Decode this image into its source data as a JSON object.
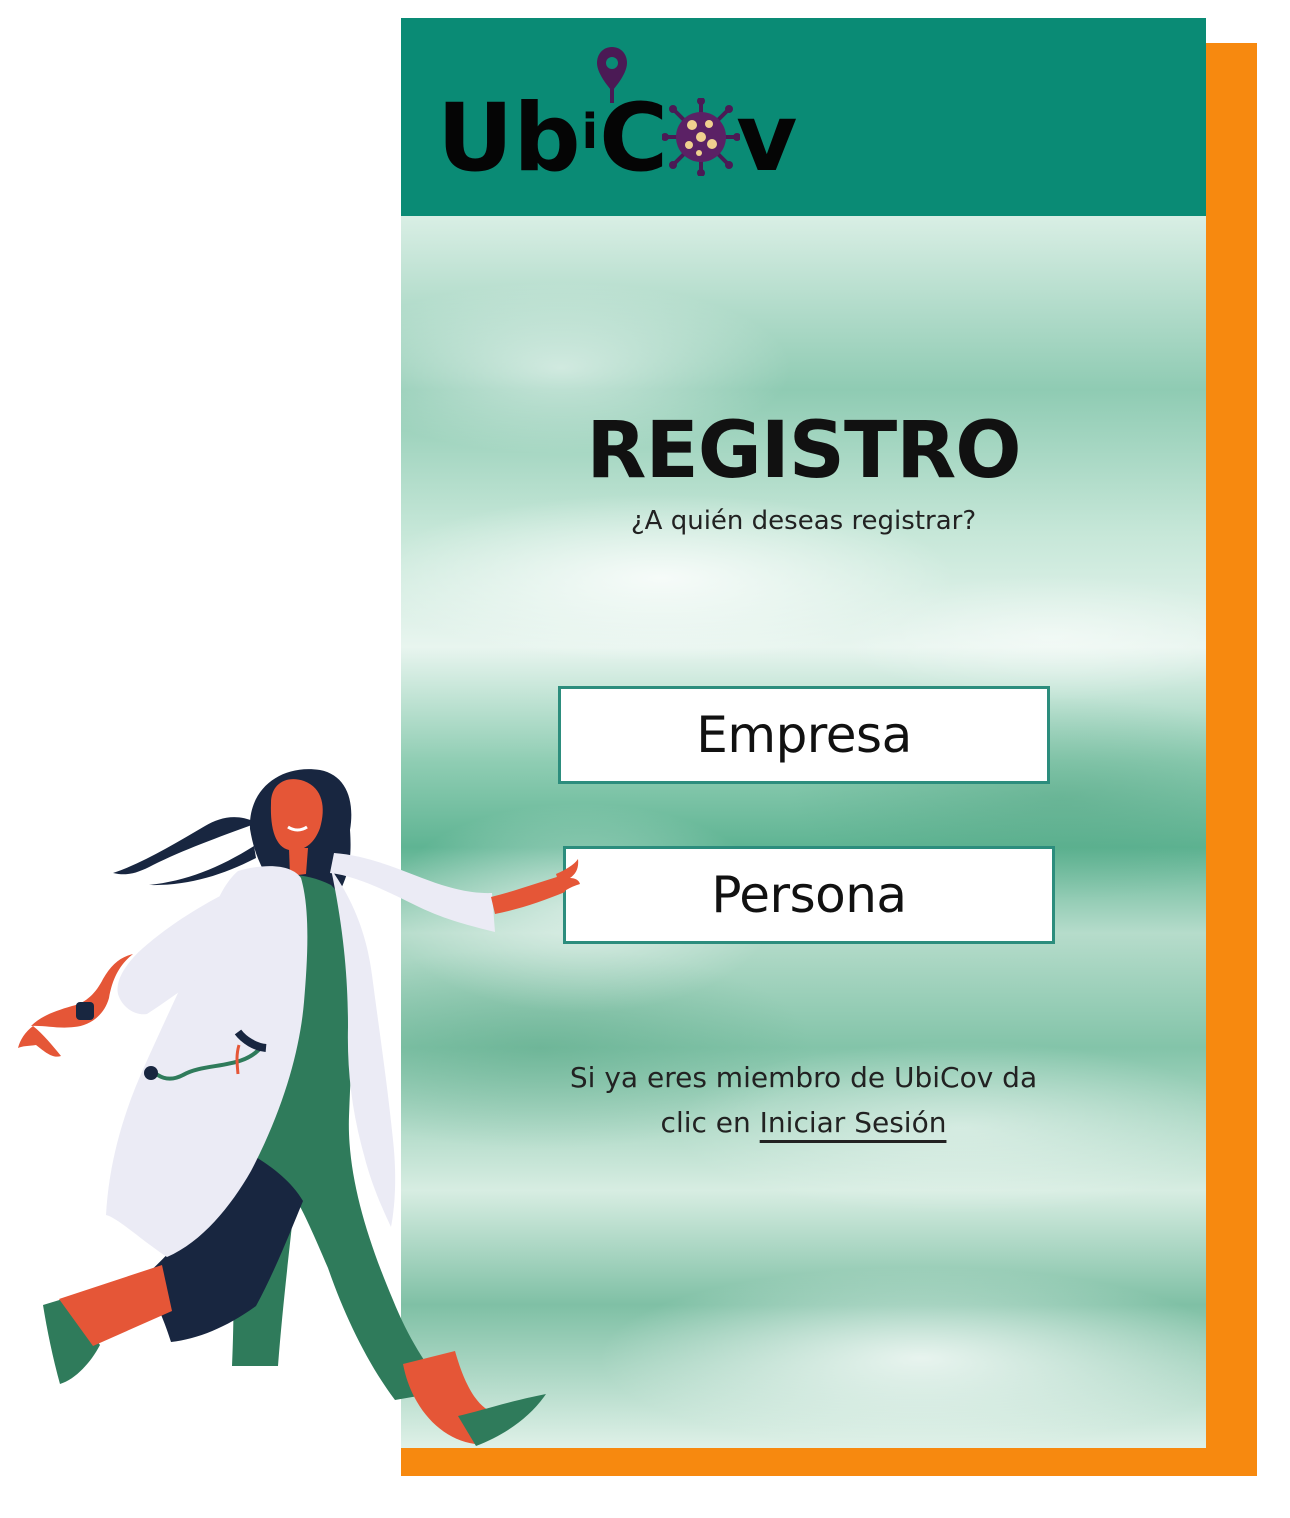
{
  "brand": {
    "logo_parts": {
      "prefix": "Ub",
      "small_i": "i",
      "c": "C",
      "v": "v"
    },
    "pin_icon": "map-pin-icon",
    "virus_icon": "virus-icon"
  },
  "page": {
    "title": "REGISTRO",
    "subtitle": "¿A quién deseas registrar?"
  },
  "options": {
    "empresa_label": "Empresa",
    "persona_label": "Persona"
  },
  "footer": {
    "line_1": "Si ya eres miembro de UbiCov da",
    "line_2_prefix": "clic en ",
    "login_link": "Iniciar Sesión"
  },
  "colors": {
    "header": "#0a8b75",
    "accent": "#f7890f",
    "button_border": "#2c8d7d",
    "doctor_coat": "#ebebf5",
    "doctor_dress": "#2f7b5b",
    "doctor_skin": "#e55637",
    "doctor_hair": "#182640"
  },
  "illustration": {
    "name": "doctor-running-illustration"
  }
}
